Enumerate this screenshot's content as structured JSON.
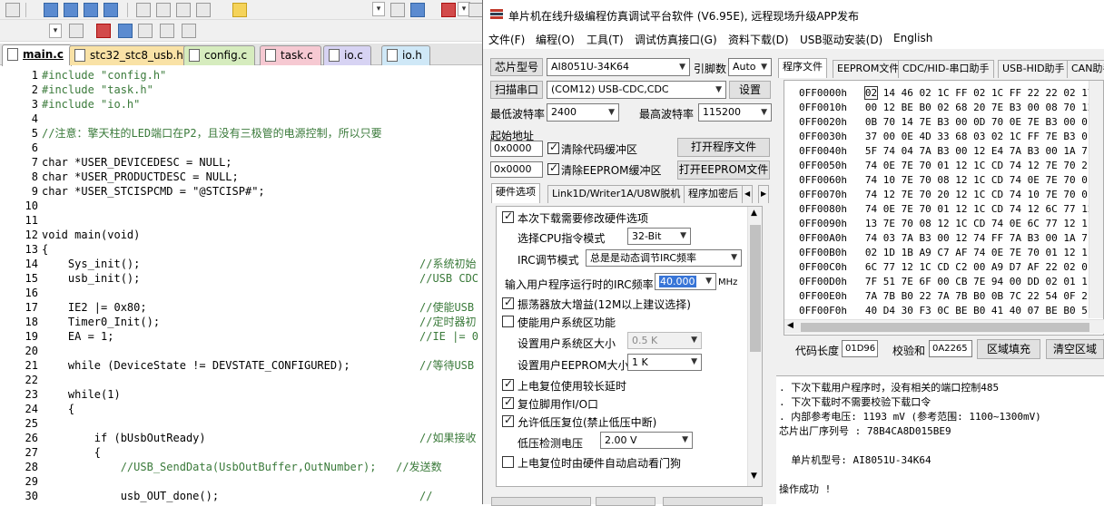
{
  "ide": {
    "tabs": [
      {
        "label": "main.c",
        "color": "#ffffff"
      },
      {
        "label": "stc32_stc8_usb.h",
        "color": "#f9e2a6"
      },
      {
        "label": "config.c",
        "color": "#d6ecbe"
      },
      {
        "label": "task.c",
        "color": "#f6c9d2"
      },
      {
        "label": "io.c",
        "color": "#d7d3f3"
      },
      {
        "label": "io.h",
        "color": "#cfe8f7"
      }
    ],
    "lines": [
      {
        "n": "1",
        "t": "#include \"config.h\""
      },
      {
        "n": "2",
        "t": "#include \"task.h\""
      },
      {
        "n": "3",
        "t": "#include \"io.h\""
      },
      {
        "n": "4",
        "t": ""
      },
      {
        "n": "5",
        "t": "//注意：擎天柱的LED端口在P2，且没有三极管的电源控制，所以只要"
      },
      {
        "n": "6",
        "t": ""
      },
      {
        "n": "7",
        "t": "char *USER_DEVICEDESC = NULL;"
      },
      {
        "n": "8",
        "t": "char *USER_PRODUCTDESC = NULL;"
      },
      {
        "n": "9",
        "t": "char *USER_STCISPCMD = \"@STCISP#\";"
      },
      {
        "n": "10",
        "t": ""
      },
      {
        "n": "11",
        "t": ""
      },
      {
        "n": "12",
        "t": "void main(void)"
      },
      {
        "n": "13",
        "t": "{"
      },
      {
        "n": "14",
        "t": "    Sys_init();",
        "c": "//系统初始"
      },
      {
        "n": "15",
        "t": "    usb_init();",
        "c": "//USB CDC"
      },
      {
        "n": "16",
        "t": ""
      },
      {
        "n": "17",
        "t": "    IE2 |= 0x80;",
        "c": "//使能USB"
      },
      {
        "n": "18",
        "t": "    Timer0_Init();",
        "c": "//定时器初"
      },
      {
        "n": "19",
        "t": "    EA = 1;",
        "c": "//IE |= 0"
      },
      {
        "n": "20",
        "t": ""
      },
      {
        "n": "21",
        "t": "    while (DeviceState != DEVSTATE_CONFIGURED);",
        "c": "//等待USB"
      },
      {
        "n": "22",
        "t": ""
      },
      {
        "n": "23",
        "t": "    while(1)"
      },
      {
        "n": "24",
        "t": "    {"
      },
      {
        "n": "25",
        "t": ""
      },
      {
        "n": "26",
        "t": "        if (bUsbOutReady)",
        "c": "//如果接收"
      },
      {
        "n": "27",
        "t": "        {"
      },
      {
        "n": "28",
        "t": "            //USB_SendData(UsbOutBuffer,OutNumber);   //发送数"
      },
      {
        "n": "29",
        "t": ""
      },
      {
        "n": "30",
        "t": "            usb_OUT_done();",
        "c": "//"
      }
    ]
  },
  "isp": {
    "title": "单片机在线升级编程仿真调试平台软件 (V6.95E), 远程现场升级APP发布",
    "menu": [
      "文件(F)",
      "编程(O)",
      "工具(T)",
      "调试仿真接口(G)",
      "资料下载(D)",
      "USB驱动安装(D)",
      "English"
    ],
    "chip_label": "芯片型号",
    "chip_value": "AI8051U-34K64",
    "pin_label": "引脚数",
    "pin_value": "Auto",
    "scan_button": "扫描串口",
    "port_value": "(COM12) USB-CDC,CDC",
    "settings_button": "设置",
    "min_baud_label": "最低波特率",
    "min_baud_value": "2400",
    "max_baud_label": "最高波特率",
    "max_baud_value": "115200",
    "start_addr_label": "起始地址",
    "addr1": "0x0000",
    "clear_code_label": "清除代码缓冲区",
    "open_prog_button": "打开程序文件",
    "addr2": "0x0000",
    "clear_eeprom_label": "清除EEPROM缓冲区",
    "open_eeprom_button": "打开EEPROM文件",
    "left_tabs": [
      "硬件选项",
      "Link1D/Writer1A/U8W脱机",
      "程序加密后"
    ],
    "hw_options": {
      "modify_hw": "本次下载需要修改硬件选项",
      "cpu_mode_label": "选择CPU指令模式",
      "cpu_mode_value": "32-Bit",
      "irc_mode_label": "IRC调节模式",
      "irc_mode_value": "总是是动态调节IRC频率",
      "irc_freq_label": "输入用户程序运行时的IRC频率",
      "irc_freq_value": "40.000",
      "irc_unit": "MHz",
      "osc_gain": "振荡器放大增益(12M以上建议选择)",
      "user_sys_area": "使能用户系统区功能",
      "sys_area_size_label": "设置用户系统区大小",
      "sys_area_size_value": "0.5 K",
      "eeprom_size_label": "设置用户EEPROM大小",
      "eeprom_size_value": "1   K",
      "power_delay": "上电复位使用较长延时",
      "reset_io": "复位脚用作I/O口",
      "low_volt_reset": "允许低压复位(禁止低压中断)",
      "low_volt_label": "低压检测电压",
      "low_volt_value": "2.00 V",
      "watchdog": "上电复位时由硬件自动启动看门狗"
    },
    "right_tabs": [
      "程序文件",
      "EEPROM文件",
      "CDC/HID-串口助手",
      "USB-HID助手",
      "CAN助手"
    ],
    "hex_rows": [
      {
        "addr": "0FF0000h",
        "bytes": "02 14 46 02 1C FF 02 1C FF 22 22 02 17"
      },
      {
        "addr": "0FF0010h",
        "bytes": "00 12 BE B0 02 68 20 7E B3 00 08 70 12"
      },
      {
        "addr": "0FF0020h",
        "bytes": "0B 70 14 7E B3 00 0D 70 0E 7E B3 00 0"
      },
      {
        "addr": "0FF0030h",
        "bytes": "37 00 0E 4D 33 68 03 02 1C FF 7E B3 0"
      },
      {
        "addr": "0FF0040h",
        "bytes": "5F 74 04 7A B3 00 12 E4 7A B3 00 1A 7"
      },
      {
        "addr": "0FF0050h",
        "bytes": "74 0E 7E 70 01 12 1C CD 74 12 7E 70 2"
      },
      {
        "addr": "0FF0060h",
        "bytes": "74 10 7E 70 08 12 1C CD 74 0E 7E 70 0"
      },
      {
        "addr": "0FF0070h",
        "bytes": "74 12 7E 70 20 12 1C CD 74 10 7E 70 0"
      },
      {
        "addr": "0FF0080h",
        "bytes": "74 0E 7E 70 01 12 1C CD 74 12 6C 77 12"
      },
      {
        "addr": "0FF0090h",
        "bytes": "13 7E 70 08 12 1C CD 74 0E 6C 77 12 1"
      },
      {
        "addr": "0FF00A0h",
        "bytes": "74 03 7A B3 00 12 74 FF 7A B3 00 1A 7"
      },
      {
        "addr": "0FF00B0h",
        "bytes": "02 1D 1B A9 C7 AF 74 0E 7E 70 01 12 1"
      },
      {
        "addr": "0FF00C0h",
        "bytes": "6C 77 12 1C CD C2 00 A9 D7 AF 22 02 0"
      },
      {
        "addr": "0FF00D0h",
        "bytes": "7F 51 7E 6F 00 CB 7E 94 00 DD 02 01 1"
      },
      {
        "addr": "0FF00E0h",
        "bytes": "7A 7B B0 22 7A 7B B0 0B 7C 22 54 0F 2"
      },
      {
        "addr": "0FF00F0h",
        "bytes": "40 D4 30 F3 0C BE B0 41 40 07 BE B0 5"
      }
    ],
    "code_len_label": "代码长度",
    "code_len_value": "01D96",
    "checksum_label": "校验和",
    "checksum_value": "0A2265",
    "fill_button": "区域填充",
    "clear_button": "清空区域",
    "log": [
      ". 下次下载用户程序时，没有相关的端口控制485",
      ". 下次下载时不需要校验下载口令",
      ". 内部参考电压: 1193 mV (参考范围: 1100~1300mV)",
      "芯片出厂序列号 : 78B4CA8D015BE9",
      "",
      "  单片机型号: AI8051U-34K64",
      "",
      "操作成功 !"
    ]
  }
}
